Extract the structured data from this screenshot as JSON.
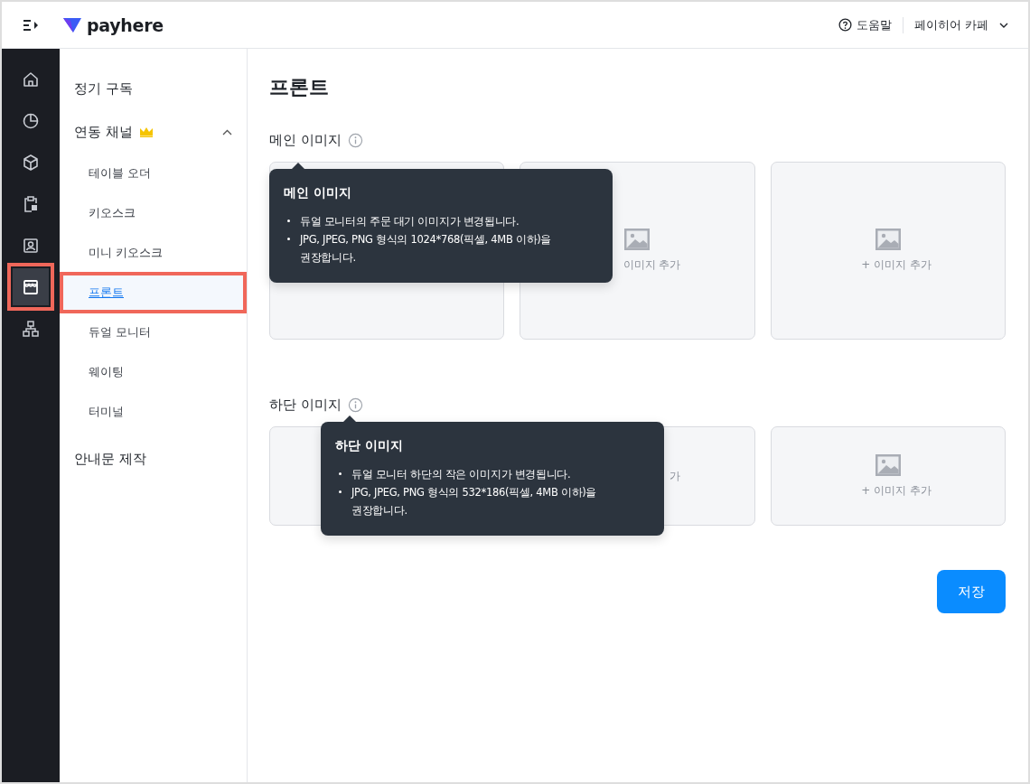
{
  "header": {
    "logo": "payhere",
    "help": "도움말",
    "store": "페이히어 카페"
  },
  "rail": [
    {
      "selected": false,
      "highlighted": false
    },
    {
      "selected": false,
      "highlighted": false
    },
    {
      "selected": false,
      "highlighted": false
    },
    {
      "selected": false,
      "highlighted": false
    },
    {
      "selected": false,
      "highlighted": false
    },
    {
      "selected": true,
      "highlighted": true
    },
    {
      "selected": false,
      "highlighted": false
    }
  ],
  "sidebar": {
    "items": [
      {
        "label": "정기 구독",
        "premium": false
      },
      {
        "label": "연동 채널",
        "premium": true,
        "expanded": true,
        "children": [
          {
            "label": "테이블 오더",
            "selected": false,
            "highlighted": false
          },
          {
            "label": "키오스크",
            "selected": false,
            "highlighted": false
          },
          {
            "label": "미니 키오스크",
            "selected": false,
            "highlighted": false
          },
          {
            "label": "프론트",
            "selected": true,
            "highlighted": true
          },
          {
            "label": "듀얼 모니터",
            "selected": false,
            "highlighted": false
          },
          {
            "label": "웨이팅",
            "selected": false,
            "highlighted": false
          },
          {
            "label": "터미널",
            "selected": false,
            "highlighted": false
          }
        ]
      },
      {
        "label": "안내문 제작",
        "premium": false
      }
    ]
  },
  "page_title": "프론트",
  "sections": [
    {
      "label": "메인 이미지",
      "cards": [
        {
          "kind": "upload"
        },
        {
          "kind": "upload",
          "icon": true,
          "label": "이미지 추가"
        },
        {
          "kind": "upload",
          "icon": true,
          "label": "+ 이미지 추가"
        }
      ],
      "tooltip": {
        "title": "메인 이미지",
        "lines": [
          "듀얼 모니터의 주문 대기 이미지가 변경됩니다.",
          "JPG, JPEG, PNG 형식의 1024*768(픽셀, 4MB 이하)을 권장합니다."
        ]
      }
    },
    {
      "label": "하단 이미지",
      "cards": [
        {
          "kind": "upload"
        },
        {
          "kind": "upload",
          "label": "가"
        },
        {
          "kind": "upload",
          "icon": true,
          "label": "+ 이미지 추가"
        }
      ],
      "tooltip": {
        "title": "하단 이미지",
        "lines": [
          "듀얼 모니터 하단의 작은 이미지가 변경됩니다.",
          "JPG, JPEG, PNG 형식의 532*186(픽셀, 4MB 이하)을 권장합니다."
        ]
      }
    }
  ],
  "save_button": "저장"
}
